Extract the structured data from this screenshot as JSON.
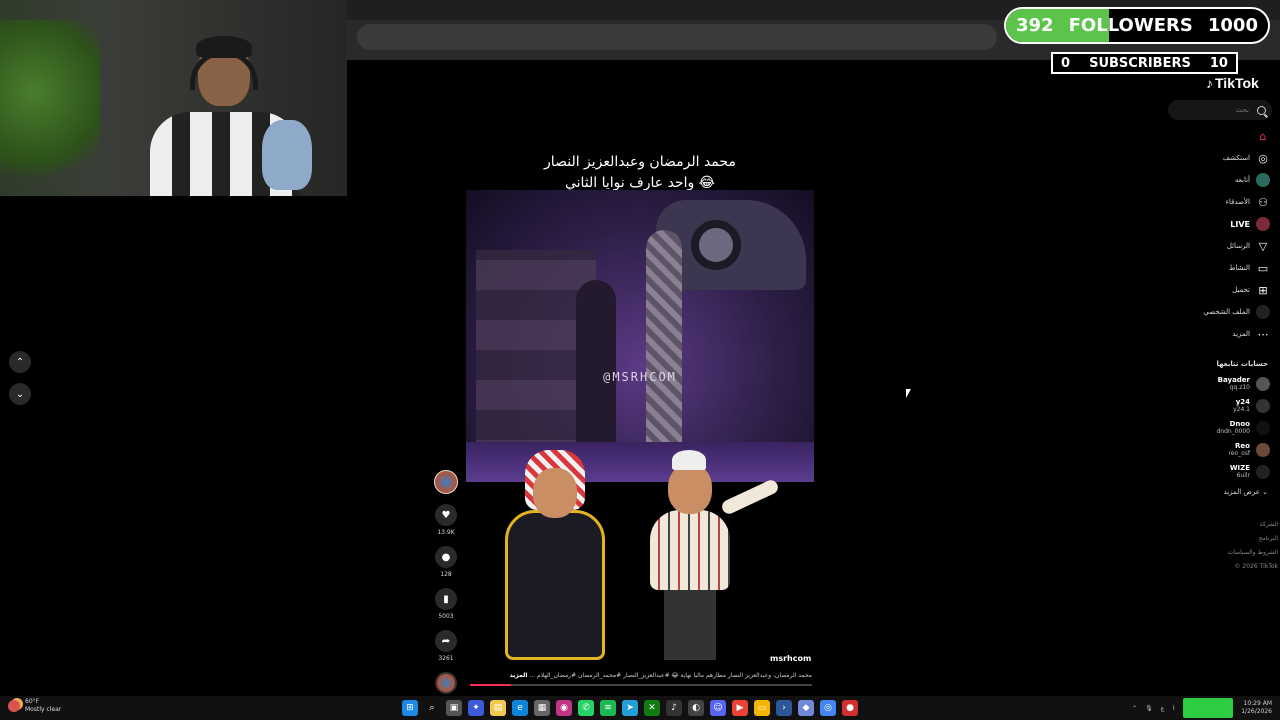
{
  "widgets": {
    "followers": {
      "current": "392",
      "label": "FOLLOWERS",
      "goal": "1000",
      "progress": 0.392
    },
    "subscribers": {
      "current": "0",
      "label": "SUBSCRIBERS",
      "goal": "10"
    }
  },
  "tiktok": {
    "logo": "TikTok",
    "search_placeholder": "بحث",
    "nav": [
      {
        "label": "",
        "icon": "home-icon"
      },
      {
        "label": "استكشف",
        "icon": "compass-icon"
      },
      {
        "label": "أتابعه",
        "icon": "avatar-icon"
      },
      {
        "label": "الأصدقاء",
        "icon": "friends-icon"
      },
      {
        "label": "LIVE",
        "icon": "live-icon"
      },
      {
        "label": "الرسائل",
        "icon": "send-icon"
      },
      {
        "label": "النشاط",
        "icon": "activity-icon"
      },
      {
        "label": "تحميل",
        "icon": "upload-icon"
      },
      {
        "label": "الملف الشخصي",
        "icon": "profile-icon"
      },
      {
        "label": "المزيد",
        "icon": "more-icon"
      }
    ],
    "following_title": "حسابات تتابعها",
    "following": [
      {
        "name": "Bayader",
        "handle": "qq.z10"
      },
      {
        "name": "y24",
        "handle": "y24.1"
      },
      {
        "name": "Dnoo",
        "handle": "dndn_0000"
      },
      {
        "name": "Reo",
        "handle": "reo_osf"
      },
      {
        "name": "WIZE",
        "handle": "6uilr"
      }
    ],
    "see_more": "عرض المزيد",
    "footer": [
      "الشركة",
      "البرنامج",
      "الشروط والسياسات",
      "© 2026 TikTok"
    ]
  },
  "video": {
    "caption_line1": "محمد الرمضان وعبدالعزيز النصار",
    "caption_line2": "واحد عارف نوايا الثاني 😂",
    "watermark": "@MSRHCOM",
    "author": "msrhcom",
    "description": "محمد الرمضان، وعبدالعزيز النصار مطارهم ماليا نهاية 😂 #عبدالعزيز_النصار #محمد_الرمضان #رمضان_الهلام ...",
    "more_label": "المزيد",
    "progress": 0.12,
    "likes": "13.9K",
    "comments": "128",
    "saves": "5003",
    "shares": "3261"
  },
  "taskbar": {
    "temperature": "60°F",
    "weather": "Mostly clear",
    "time": "10:29 AM",
    "date": "1/26/2026"
  },
  "colors": {
    "accent": "#fe2c55",
    "goal_green": "#5cc44a"
  }
}
